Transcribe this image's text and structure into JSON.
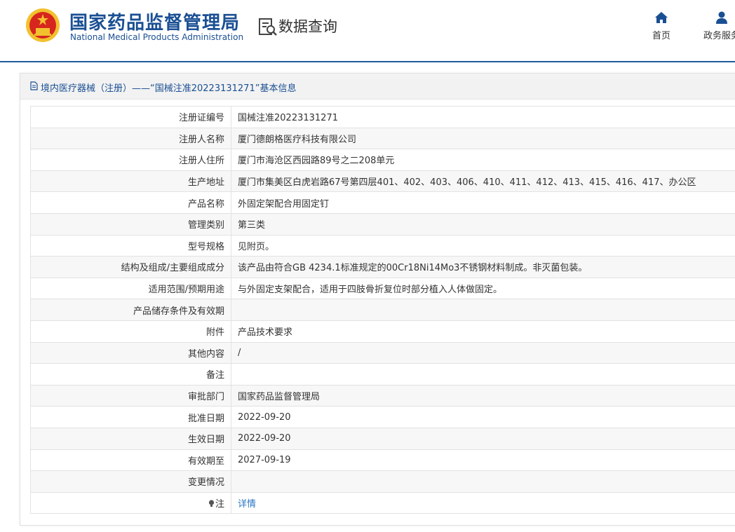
{
  "header": {
    "site_title_cn": "国家药品监督管理局",
    "site_title_en": "National Medical Products Administration",
    "query_title": "数据查询",
    "nav": [
      {
        "label": "首页",
        "icon": "home-icon"
      },
      {
        "label": "政务服务",
        "icon": "user-icon"
      }
    ]
  },
  "panel": {
    "title": "境内医疗器械（注册）——“国械注准20223131271”基本信息",
    "icon": "document-icon"
  },
  "rows": [
    {
      "label": "注册证编号",
      "value": "国械注准20223131271"
    },
    {
      "label": "注册人名称",
      "value": "厦门德朗格医疗科技有限公司"
    },
    {
      "label": "注册人住所",
      "value": "厦门市海沧区西园路89号之二208单元"
    },
    {
      "label": "生产地址",
      "value": "厦门市集美区白虎岩路67号第四层401、402、403、406、410、411、412、413、415、416、417、办公区"
    },
    {
      "label": "产品名称",
      "value": "外固定架配合用固定钉"
    },
    {
      "label": "管理类别",
      "value": "第三类"
    },
    {
      "label": "型号规格",
      "value": "见附页。"
    },
    {
      "label": "结构及组成/主要组成成分",
      "value": "该产品由符合GB 4234.1标准规定的00Cr18Ni14Mo3不锈钢材料制成。非灭菌包装。"
    },
    {
      "label": "适用范围/预期用途",
      "value": "与外固定支架配合，适用于四肢骨折复位时部分植入人体做固定。"
    },
    {
      "label": "产品储存条件及有效期",
      "value": ""
    },
    {
      "label": "附件",
      "value": "产品技术要求"
    },
    {
      "label": "其他内容",
      "value": "/"
    },
    {
      "label": "备注",
      "value": ""
    },
    {
      "label": "审批部门",
      "value": "国家药品监督管理局"
    },
    {
      "label": "批准日期",
      "value": "2022-09-20"
    },
    {
      "label": "生效日期",
      "value": "2022-09-20"
    },
    {
      "label": "有效期至",
      "value": "2027-09-19"
    },
    {
      "label": "变更情况",
      "value": ""
    }
  ],
  "note_row": {
    "label": "注",
    "link": "详情",
    "icon": "lightbulb-icon"
  },
  "colors": {
    "brand_blue": "#1a4f93",
    "link_blue": "#2a76c3",
    "emblem_red": "#d7261e",
    "emblem_gold": "#f2c12e"
  }
}
